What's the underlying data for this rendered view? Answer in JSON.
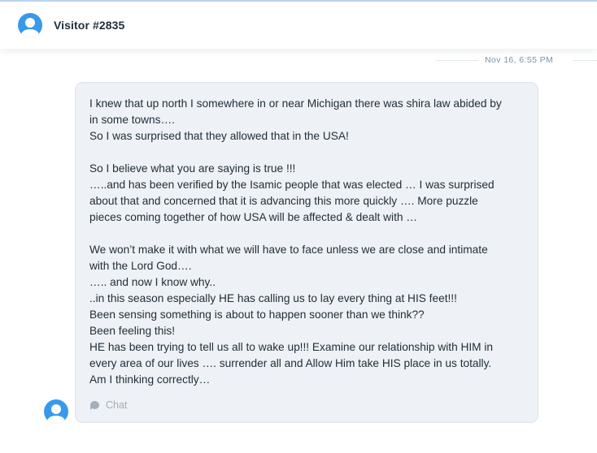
{
  "colors": {
    "accent": "#3899ec",
    "bubble_bg": "#eef1f5",
    "text": "#1f2d38",
    "muted": "#a3afba"
  },
  "header": {
    "visitor_name": "Visitor #2835",
    "avatar_icon": "user-avatar-icon"
  },
  "timestamp": "Nov 16, 6:55 PM",
  "message": {
    "lines": [
      "I knew that up north I somewhere in or near Michigan there was shira law abided by",
      "in some towns….",
      "So I was surprised that they allowed that in the USA!",
      "",
      "So I believe what you are saying is true !!!",
      "…..and has been verified by the Isamic people that was elected … I was surprised",
      "about that and concerned that it is advancing this more quickly …. More puzzle",
      "pieces coming together of how USA will be affected & dealt with …",
      "",
      "We won’t make it with what we will have to face unless we are close and intimate",
      "with the Lord God….",
      "….. and now I know why..",
      "..in this season especially HE has calling us to lay every thing at HIS feet!!!",
      "Been sensing something is about to happen sooner than we think??",
      "Been feeling this!",
      "HE has been trying to tell us all to wake up!!! Examine our relationship with HIM in",
      "every area of our lives …. surrender all and Allow Him take HIS place in us totally.",
      "Am I thinking correctly…"
    ],
    "channel_label": "Chat",
    "channel_icon": "chat-bubble-icon"
  }
}
